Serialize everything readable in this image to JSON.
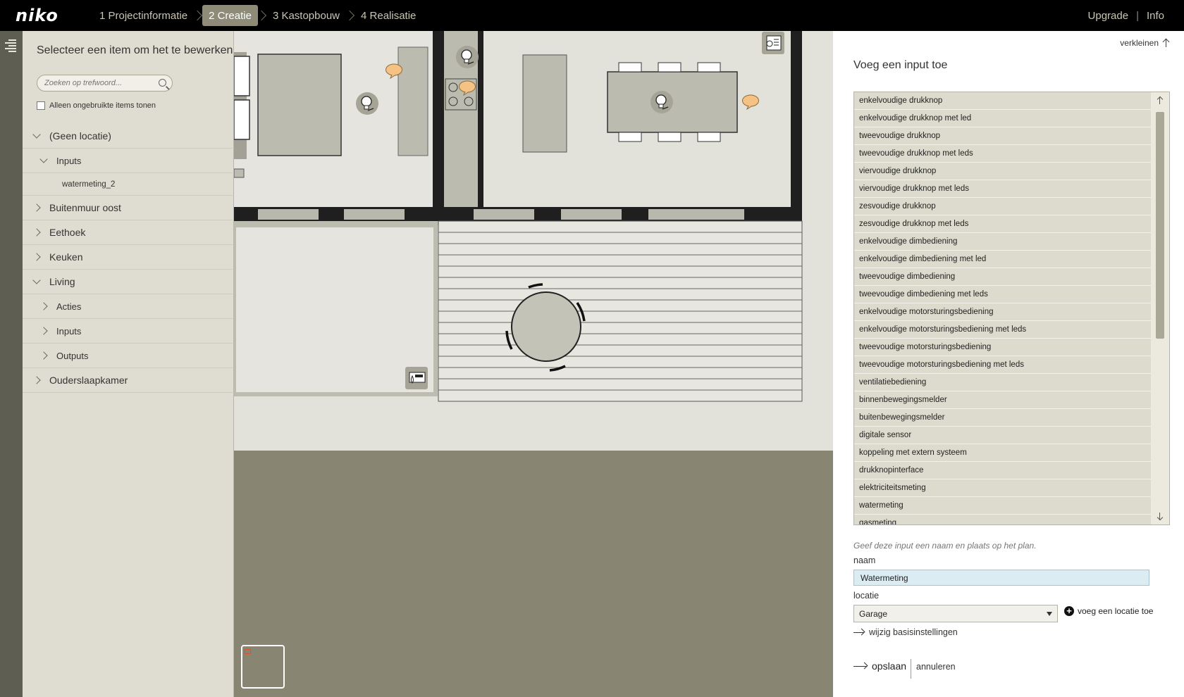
{
  "topbar": {
    "logo": "niko",
    "steps": [
      "1 Projectinformatie",
      "2 Creatie",
      "3 Kastopbouw",
      "4 Realisatie"
    ],
    "active_step": 1,
    "upgrade": "Upgrade",
    "separator": "|",
    "info": "Info"
  },
  "left": {
    "title": "Selecteer een item om het te bewerken",
    "search_placeholder": "Zoeken op trefwoord...",
    "unused_label": "Alleen ongebruikte items tonen",
    "tree": [
      {
        "label": "(Geen locatie)",
        "level": 0,
        "expanded": true
      },
      {
        "label": "Inputs",
        "level": 1,
        "expanded": true
      },
      {
        "label": "watermeting_2",
        "level": 2,
        "leaf": true
      },
      {
        "label": "Buitenmuur oost",
        "level": 0,
        "expanded": false
      },
      {
        "label": "Eethoek",
        "level": 0,
        "expanded": false
      },
      {
        "label": "Keuken",
        "level": 0,
        "expanded": false
      },
      {
        "label": "Living",
        "level": 0,
        "expanded": true
      },
      {
        "label": "Acties",
        "level": 1,
        "expanded": false
      },
      {
        "label": "Inputs",
        "level": 1,
        "expanded": false
      },
      {
        "label": "Outputs",
        "level": 1,
        "expanded": false
      },
      {
        "label": "Ouderslaapkamer",
        "level": 0,
        "expanded": false
      }
    ]
  },
  "right": {
    "collapse": "verkleinen",
    "title": "Voeg een input toe",
    "inputs": [
      "enkelvoudige drukknop",
      "enkelvoudige drukknop met led",
      "tweevoudige drukknop",
      "tweevoudige drukknop met leds",
      "viervoudige drukknop",
      "viervoudige drukknop met leds",
      "zesvoudige drukknop",
      "zesvoudige drukknop met leds",
      "enkelvoudige dimbediening",
      "enkelvoudige dimbediening met led",
      "tweevoudige dimbediening",
      "tweevoudige dimbediening met leds",
      "enkelvoudige motorsturingsbediening",
      "enkelvoudige motorsturingsbediening met leds",
      "tweevoudige motorsturingsbediening",
      "tweevoudige motorsturingsbediening met leds",
      "ventilatiebediening",
      "binnenbewegingsmelder",
      "buitenbewegingsmelder",
      "digitale sensor",
      "koppeling met extern systeem",
      "drukknopinterface",
      "elektriciteitsmeting",
      "watermeting",
      "gasmeting"
    ],
    "hint": "Geef deze input een naam en plaats op het plan.",
    "naam_label": "naam",
    "naam_value": "Watermeting",
    "locatie_label": "locatie",
    "locatie_value": "Garage",
    "add_location": "voeg een locatie toe",
    "basic_settings": "wijzig basisinstellingen",
    "save": "opslaan",
    "cancel": "annuleren"
  },
  "colors": {
    "topbar": "#000000",
    "active_step": "#8e8b78",
    "panel": "#dfddd1",
    "plan_bg": "#888572",
    "floor": "#e2e1da",
    "bubble": "#f5c283"
  },
  "icons": [
    "menu-icon",
    "search-icon",
    "chevron-right-icon",
    "chevron-down-icon",
    "bulb-icon",
    "comment-bubble-icon",
    "water-meter-icon",
    "legend-icon",
    "arrow-up-icon",
    "arrow-down-icon",
    "arrow-right-icon",
    "plus-circle-icon",
    "caret-down-icon"
  ]
}
